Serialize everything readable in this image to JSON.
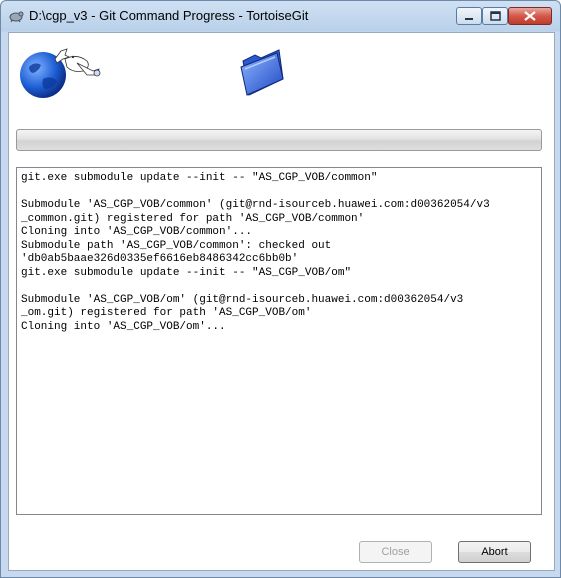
{
  "window": {
    "title": "D:\\cgp_v3 - Git Command Progress - TortoiseGit"
  },
  "icons": {
    "app": "tortoisegit-icon",
    "globe": "globe-tortoise-icon",
    "folder": "folder-icon"
  },
  "progress": {
    "value": 0
  },
  "log": {
    "lines": [
      "git.exe submodule update --init -- \"AS_CGP_VOB/common\"",
      "",
      "Submodule 'AS_CGP_VOB/common' (git@rnd-isourceb.huawei.com:d00362054/v3",
      "_common.git) registered for path 'AS_CGP_VOB/common'",
      "Cloning into 'AS_CGP_VOB/common'...",
      "Submodule path 'AS_CGP_VOB/common': checked out",
      "'db0ab5baae326d0335ef6616eb8486342cc6bb0b'",
      "git.exe submodule update --init -- \"AS_CGP_VOB/om\"",
      "",
      "Submodule 'AS_CGP_VOB/om' (git@rnd-isourceb.huawei.com:d00362054/v3",
      "_om.git) registered for path 'AS_CGP_VOB/om'",
      "Cloning into 'AS_CGP_VOB/om'..."
    ]
  },
  "buttons": {
    "close_label": "Close",
    "abort_label": "Abort"
  },
  "colors": {
    "title_bar": "#b9d1ea",
    "close_control": "#c03a2b"
  }
}
